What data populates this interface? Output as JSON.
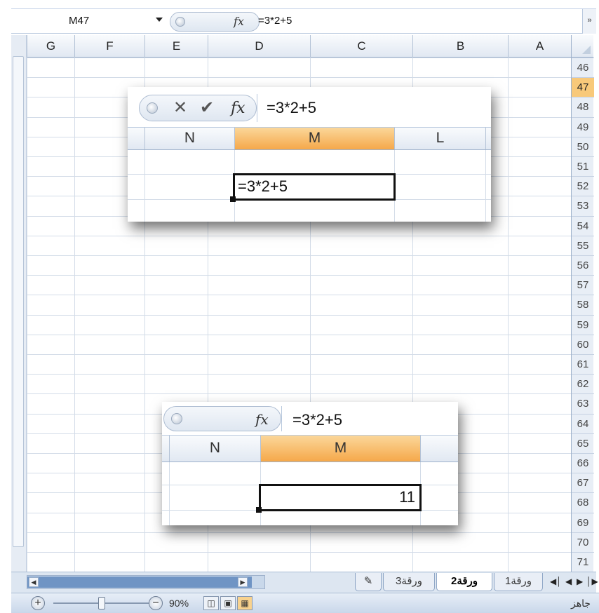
{
  "formula_bar": {
    "name_box": "M47",
    "fx": "fx",
    "formula": "=3*2+5",
    "expand": "»"
  },
  "columns": [
    "G",
    "F",
    "E",
    "D",
    "C",
    "B",
    "A"
  ],
  "rows": [
    "46",
    "47",
    "48",
    "49",
    "50",
    "51",
    "52",
    "53",
    "54",
    "55",
    "56",
    "57",
    "58",
    "59",
    "60",
    "61",
    "62",
    "63",
    "64",
    "65",
    "66",
    "67",
    "68",
    "69",
    "70",
    "71"
  ],
  "active_row": "47",
  "callout_edit": {
    "cancel_icon": "✕",
    "enter_icon": "✔",
    "fx": "fx",
    "formula": "=3*2+5",
    "columns": [
      "N",
      "M",
      "L"
    ],
    "cell_text": "=3*2+5"
  },
  "callout_result": {
    "fx": "fx",
    "formula": "=3*2+5",
    "columns": [
      "N",
      "M"
    ],
    "cell_value": "11"
  },
  "sheet_tabs": [
    "ورقة1",
    "ورقة2",
    "ورقة3"
  ],
  "active_tab": "ورقة2",
  "status_bar": {
    "zoom_level": "90%",
    "status_text": "جاهز",
    "zoom_out": "−",
    "zoom_in": "+"
  },
  "colors": {
    "accent_orange": "#f5a84a",
    "header_blue": "#e1e8f2"
  }
}
